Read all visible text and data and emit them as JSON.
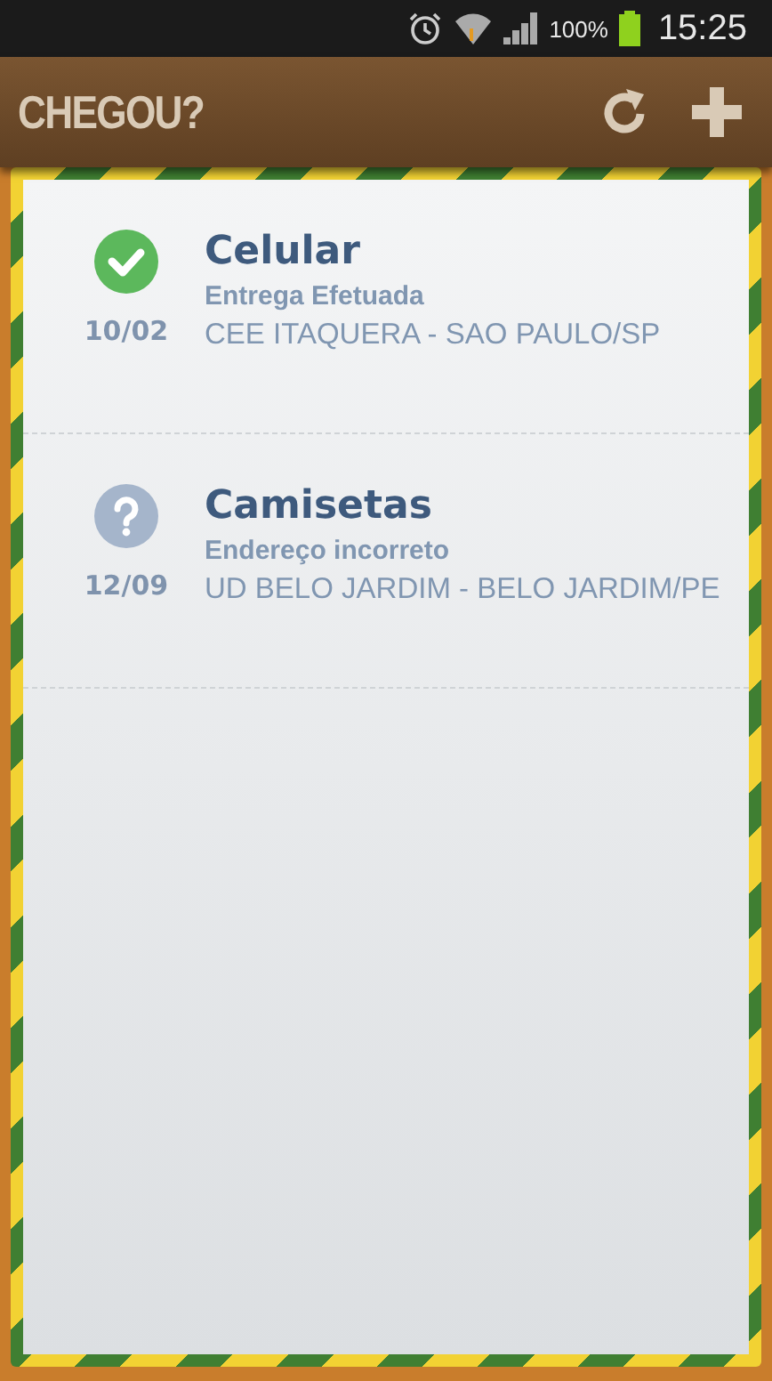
{
  "status_bar": {
    "battery": "100%",
    "time": "15:25"
  },
  "app_bar": {
    "title": "CHEGOU?"
  },
  "deliveries": [
    {
      "kind": "delivered",
      "date": "10/02",
      "name": "Celular",
      "status": "Entrega Efetuada",
      "location": "CEE ITAQUERA - SAO PAULO/SP"
    },
    {
      "kind": "unknown",
      "date": "12/09",
      "name": "Camisetas",
      "status": "Endereço incorreto",
      "location": "UD BELO JARDIM - BELO JARDIM/PE"
    }
  ]
}
